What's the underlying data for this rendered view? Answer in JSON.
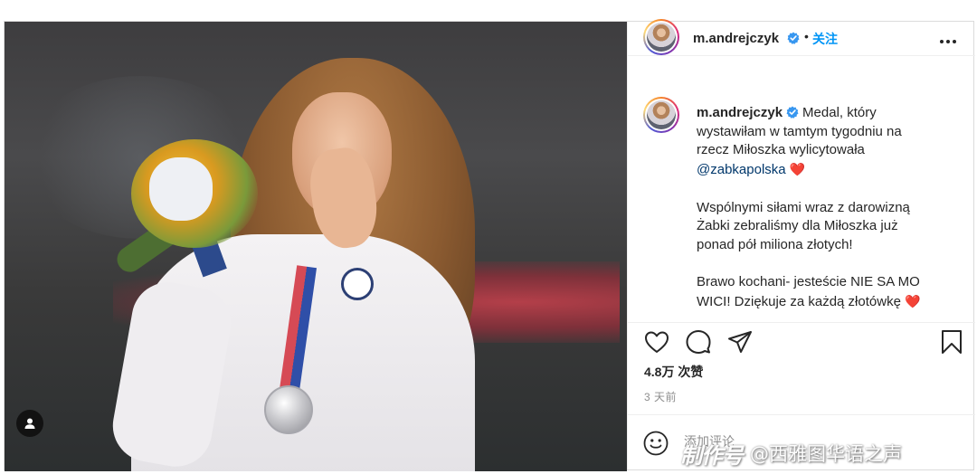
{
  "post": {
    "username": "m.andrejczyk",
    "header_dot": "•",
    "follow_label": "关注",
    "caption_lines": [
      "Medal, który",
      "wystawiłam w tamtym tygodniu na",
      "rzecz Miłoszka wylicytowała"
    ],
    "mention": "@zabkapolska",
    "paragraph2": [
      "Wspólnymi siłami wraz z darowizną",
      "Żabki zebraliśmy dla Miłoszka już",
      "ponad pół miliona złotych!"
    ],
    "paragraph3": [
      "Brawo kochani- jesteście NIE SA MO",
      "WICI! Dziękuje za każdą złotówkę"
    ],
    "heart_emoji": "❤️",
    "likes": "4.8万 次赞",
    "time": "3 天前",
    "comment_placeholder": "添加评论"
  },
  "watermark": {
    "logo": "制作号",
    "text": "@西雅图华语之声"
  },
  "colors": {
    "link_blue": "#0095f6",
    "mention_blue": "#00376b",
    "verified_blue": "#3897f0",
    "heart_red": "#ed1c3a",
    "muted_gray": "#8e8e8e"
  },
  "icons": [
    "verified-icon",
    "more-icon",
    "heart-icon",
    "comment-icon",
    "share-icon",
    "bookmark-icon",
    "emoji-icon",
    "user-tag-icon"
  ]
}
